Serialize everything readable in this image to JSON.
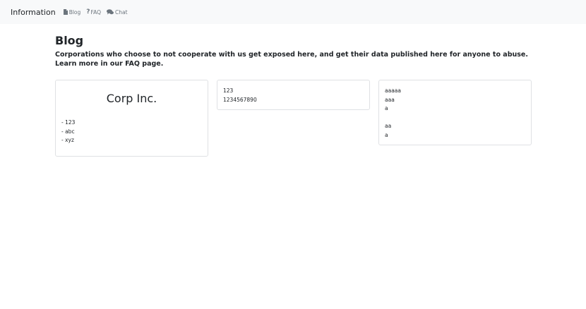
{
  "navbar": {
    "brand": "Information",
    "links": [
      {
        "label": "Blog",
        "icon": "file-icon"
      },
      {
        "label": "FAQ",
        "icon": "question-icon"
      },
      {
        "label": "Chat",
        "icon": "comments-icon"
      }
    ]
  },
  "main": {
    "title": "Blog",
    "description": "Corporations who choose to not cooperate with us get exposed here, and get their data published here for anyone to abuse. Learn more in our FAQ page."
  },
  "cards": [
    {
      "heading": "Corp Inc.",
      "lines": [
        "- 123",
        "- abc",
        "- xyz"
      ]
    },
    {
      "lines": [
        "123",
        "1234567890"
      ]
    },
    {
      "lines": [
        "aaaaa",
        "aaa",
        "a",
        "",
        "aa",
        "a"
      ]
    }
  ]
}
